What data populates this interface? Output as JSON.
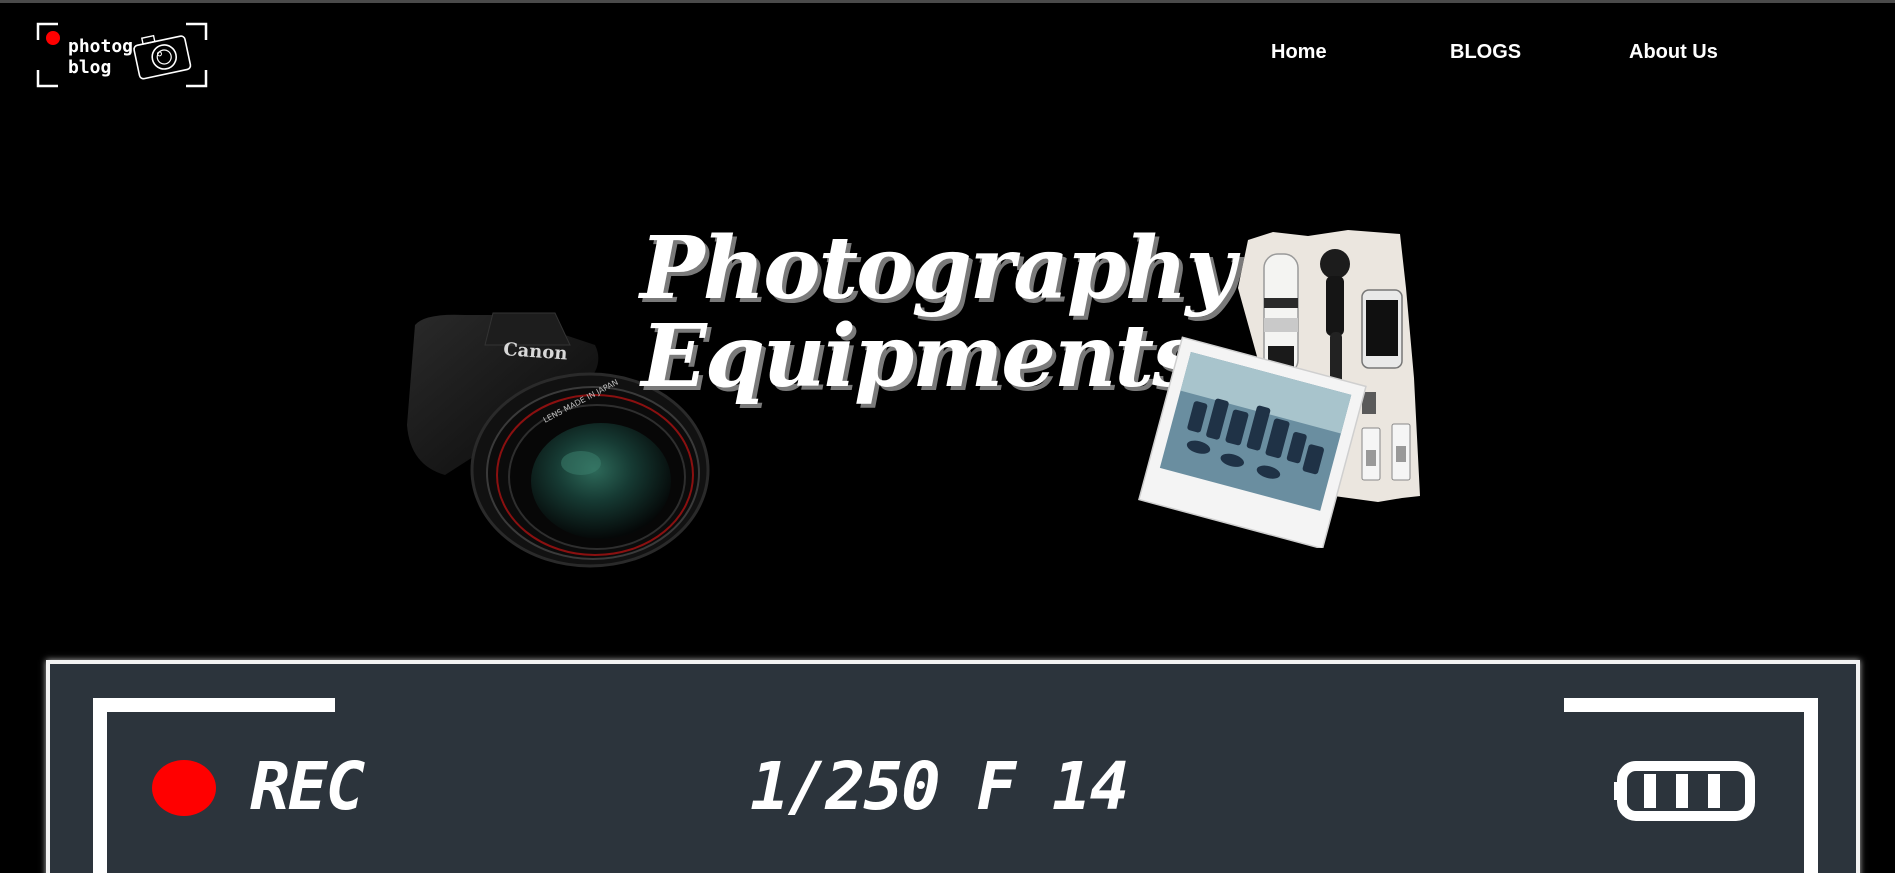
{
  "logo": {
    "line1": "photog",
    "line2": "blog",
    "camera_icon": "camera-icon",
    "dot_color": "#ff0000"
  },
  "nav": {
    "home": "Home",
    "blogs": "BLOGS",
    "about": "About Us"
  },
  "hero": {
    "title_line1": "Photography",
    "title_line2": "Equipments",
    "camera_image": "dslr-camera-image",
    "collage_image": "equipment-collage-image"
  },
  "viewfinder": {
    "rec_label": "REC",
    "exposure": "1/250 F 14",
    "rec_color": "#ff0000",
    "panel_color": "#2c343c",
    "battery_icon": "battery-icon"
  }
}
